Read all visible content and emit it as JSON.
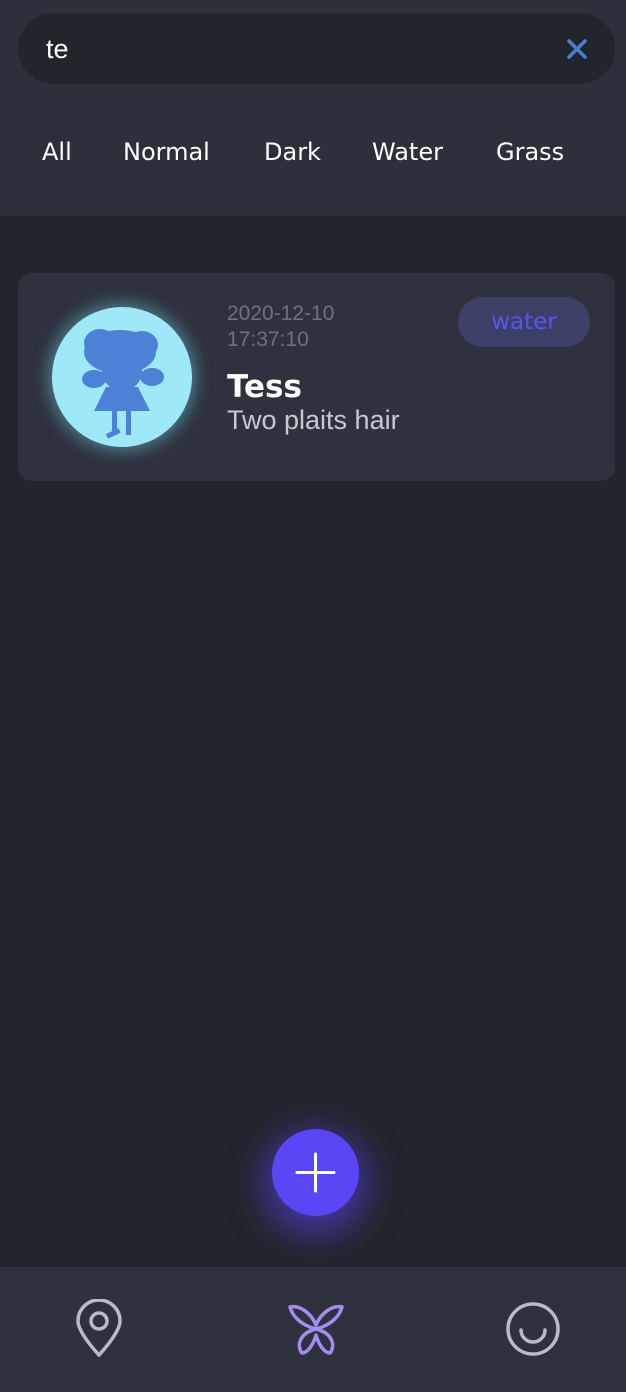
{
  "search": {
    "value": "te",
    "clear_icon": "close-icon"
  },
  "filters": [
    {
      "label": "All"
    },
    {
      "label": "Normal"
    },
    {
      "label": "Dark"
    },
    {
      "label": "Water"
    },
    {
      "label": "Grass"
    }
  ],
  "results": [
    {
      "date": "2020-12-10",
      "time": "17:37:10",
      "name": "Tess",
      "description": "Two plaits hair",
      "type": "water",
      "avatar_icon": "character-silhouette-icon"
    }
  ],
  "fab": {
    "icon": "plus-icon"
  },
  "bottom_nav": [
    {
      "icon": "location-pin-icon",
      "active": false
    },
    {
      "icon": "butterfly-icon",
      "active": true
    },
    {
      "icon": "smile-icon",
      "active": false
    }
  ],
  "colors": {
    "background": "#22252b",
    "header": "#2b303a",
    "card": "#2e323e",
    "accent": "#5946f5",
    "tag_text": "#5a55f0",
    "tag_bg": "#3c3f66",
    "active_nav": "#a58cf0",
    "inactive_nav": "#b9bcc2"
  }
}
